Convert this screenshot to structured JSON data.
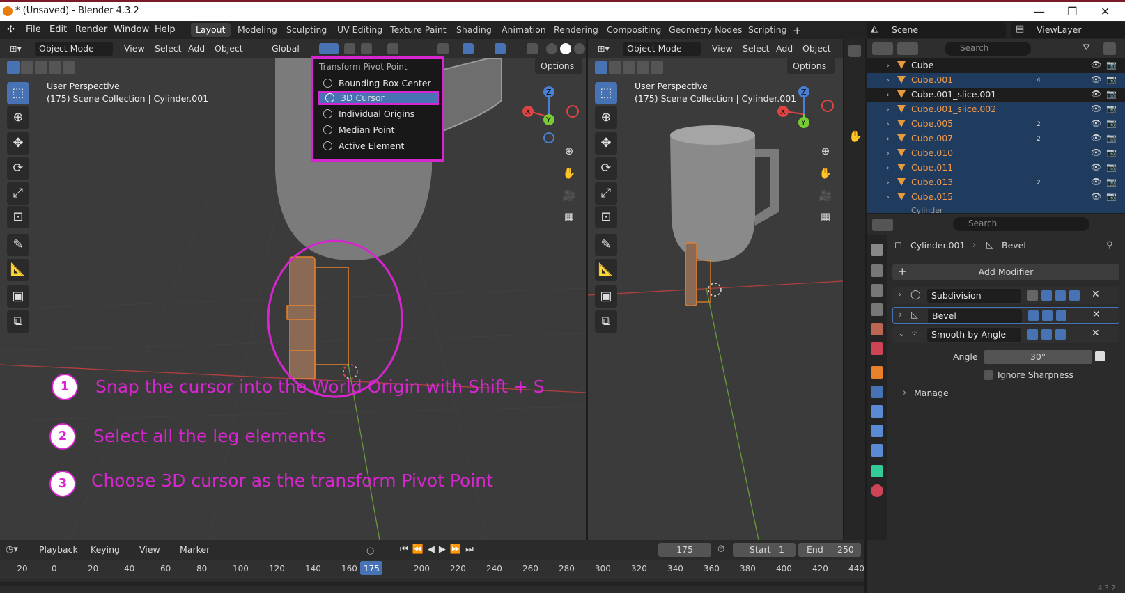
{
  "window": {
    "title": "* (Unsaved) - Blender 4.3.2"
  },
  "menu": [
    "File",
    "Edit",
    "Render",
    "Window",
    "Help"
  ],
  "workspaces": [
    "Layout",
    "Modeling",
    "Sculpting",
    "UV Editing",
    "Texture Paint",
    "Shading",
    "Animation",
    "Rendering",
    "Compositing",
    "Geometry Nodes",
    "Scripting"
  ],
  "scene": {
    "label": "Scene",
    "viewlayer": "ViewLayer"
  },
  "viewport_left": {
    "mode": "Object Mode",
    "menus": [
      "View",
      "Select",
      "Add",
      "Object"
    ],
    "orientation": "Global",
    "options": "Options",
    "info_line1": "User Perspective",
    "info_line2": "(175) Scene Collection | Cylinder.001"
  },
  "viewport_right": {
    "mode": "Object Mode",
    "menus": [
      "View",
      "Select",
      "Add",
      "Object"
    ],
    "options": "Options",
    "info_line1": "User Perspective",
    "info_line2": "(175) Scene Collection | Cylinder.001"
  },
  "pivot_menu": {
    "title": "Transform Pivot Point",
    "items": [
      "Bounding Box Center",
      "3D Cursor",
      "Individual Origins",
      "Median Point",
      "Active Element"
    ],
    "selected_index": 1
  },
  "annotations": [
    {
      "num": "1",
      "text": "Snap the cursor into the World Origin with Shift + S"
    },
    {
      "num": "2",
      "text": "Select all the leg elements"
    },
    {
      "num": "3",
      "text": "Choose 3D cursor as the transform Pivot Point"
    }
  ],
  "outliner": {
    "search_placeholder": "Search",
    "rows": [
      {
        "name": "Cube",
        "selected": false,
        "sub": ""
      },
      {
        "name": "Cube.001",
        "selected": true,
        "sub": "4"
      },
      {
        "name": "Cube.001_slice.001",
        "selected": false,
        "sub": ""
      },
      {
        "name": "Cube.001_slice.002",
        "selected": true,
        "sub": ""
      },
      {
        "name": "Cube.005",
        "selected": true,
        "sub": "2"
      },
      {
        "name": "Cube.007",
        "selected": true,
        "sub": "2"
      },
      {
        "name": "Cube.010",
        "selected": true,
        "sub": ""
      },
      {
        "name": "Cube.011",
        "selected": true,
        "sub": ""
      },
      {
        "name": "Cube.013",
        "selected": true,
        "sub": "2"
      },
      {
        "name": "Cube.015",
        "selected": true,
        "sub": ""
      }
    ],
    "partial_row": "Cylinder"
  },
  "properties": {
    "search_placeholder": "Search",
    "object": "Cylinder.001",
    "modifier": "Bevel",
    "add_modifier": "Add Modifier",
    "modifiers": [
      "Subdivision",
      "Bevel",
      "Smooth by Angle"
    ],
    "angle_label": "Angle",
    "angle_value": "30°",
    "ignore_sharpness": "Ignore Sharpness",
    "manage": "Manage"
  },
  "timeline": {
    "menus": [
      "Playback",
      "Keying",
      "View",
      "Marker"
    ],
    "current_frame": "175",
    "start_label": "Start",
    "start": "1",
    "end_label": "End",
    "end": "250",
    "ticks": [
      "-20",
      "0",
      "20",
      "40",
      "60",
      "80",
      "100",
      "120",
      "140",
      "160",
      "175",
      "200",
      "220",
      "240",
      "260",
      "280",
      "300",
      "320",
      "340",
      "360",
      "380",
      "400",
      "420",
      "440"
    ],
    "version": "4.3.2"
  },
  "colors": {
    "annotation": "#d726cf",
    "selection": "#4772b3",
    "object_orange": "#e8822a"
  }
}
